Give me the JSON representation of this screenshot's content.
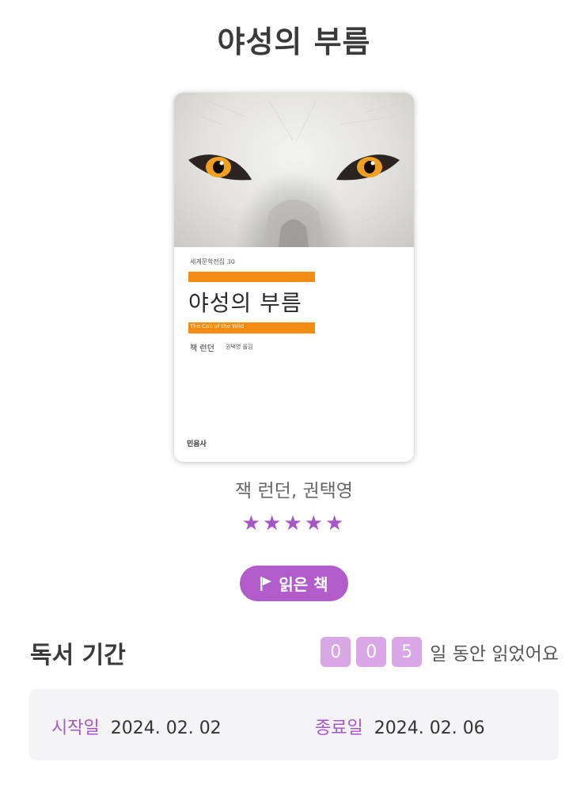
{
  "book": {
    "title": "야성의 부름",
    "authors": "잭 런던, 권택영",
    "rating": 5,
    "rating_display": "★★★★★",
    "cover": {
      "series": "세계문학전집 30",
      "title": "야성의 부름",
      "subtitle": "The Call of the Wild",
      "author": "잭 런던",
      "translator": "권택영 옮김",
      "publisher": "민음사",
      "bar_color": "#f28c12",
      "eye_color": "#f0a020"
    }
  },
  "status": {
    "label": "읽은 책",
    "icon": "flag-icon",
    "color": "#b25ccc"
  },
  "reading_period": {
    "section_title": "독서 기간",
    "days_digits": [
      "0",
      "0",
      "5"
    ],
    "days_suffix": "일 동안 읽었어요",
    "start_label": "시작일",
    "start_date": "2024. 02. 02",
    "end_label": "종료일",
    "end_date": "2024. 02. 06"
  },
  "colors": {
    "accent": "#a855c8",
    "digit_bg": "#d9a6e6",
    "period_bg": "#f4f4f6"
  }
}
